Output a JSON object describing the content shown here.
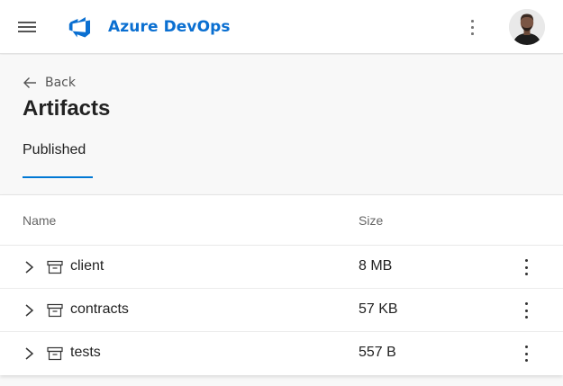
{
  "header": {
    "brand": "Azure DevOps",
    "brand_color": "#0a6fd1",
    "menu_icon": "hamburger-icon",
    "more_icon": "more-vertical-icon",
    "avatar": "user-avatar"
  },
  "page": {
    "back_label": "Back",
    "title": "Artifacts",
    "tabs": [
      {
        "label": "Published",
        "selected": true
      }
    ],
    "accent_color": "#0078d4"
  },
  "table": {
    "columns": [
      "Name",
      "Size"
    ],
    "rows": [
      {
        "name": "client",
        "size": "8 MB"
      },
      {
        "name": "contracts",
        "size": "57 KB"
      },
      {
        "name": "tests",
        "size": "557 B"
      }
    ]
  }
}
